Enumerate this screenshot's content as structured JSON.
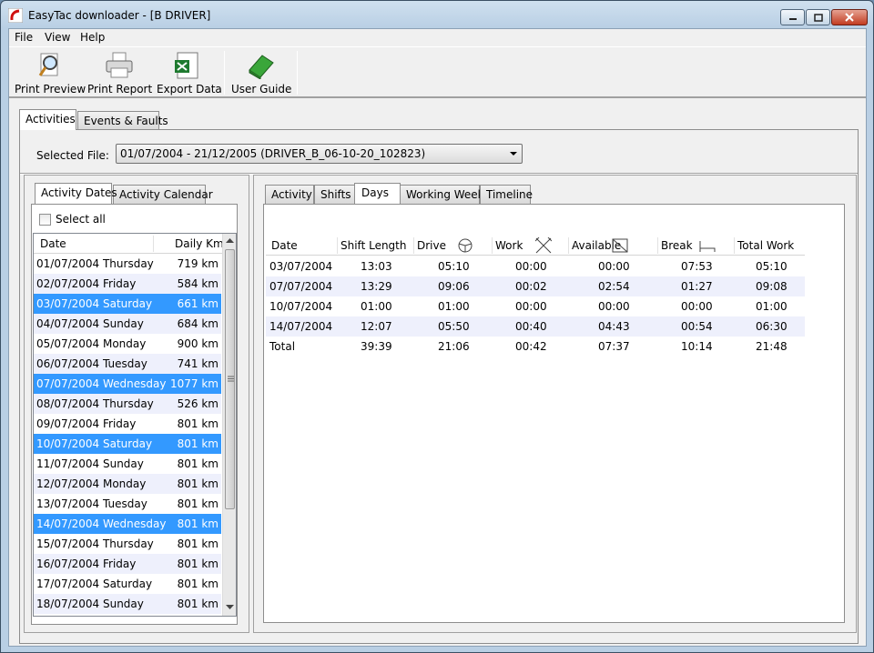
{
  "window": {
    "title": "EasyTac downloader - [B DRIVER]"
  },
  "menu": [
    "File",
    "View",
    "Help"
  ],
  "toolbar": {
    "print_preview": "Print Preview",
    "print_report": "Print Report",
    "export_data": "Export Data",
    "user_guide": "User Guide"
  },
  "main_tabs": [
    "Activities",
    "Events & Faults"
  ],
  "selected_file": {
    "label": "Selected File:",
    "value": "01/07/2004 - 21/12/2005 (DRIVER_B_06-10-20_102823)"
  },
  "left_tabs": [
    "Activity Dates",
    "Activity Calendar"
  ],
  "select_all": "Select all",
  "dates_list": {
    "columns": [
      "Date",
      "Daily Km"
    ],
    "rows": [
      {
        "date": "01/07/2004 Thursday",
        "km": "719 km",
        "selected": false
      },
      {
        "date": "02/07/2004 Friday",
        "km": "584 km",
        "selected": false
      },
      {
        "date": "03/07/2004 Saturday",
        "km": "661 km",
        "selected": true
      },
      {
        "date": "04/07/2004 Sunday",
        "km": "684 km",
        "selected": false
      },
      {
        "date": "05/07/2004 Monday",
        "km": "900 km",
        "selected": false
      },
      {
        "date": "06/07/2004 Tuesday",
        "km": "741 km",
        "selected": false
      },
      {
        "date": "07/07/2004 Wednesday",
        "km": "1077 km",
        "selected": true
      },
      {
        "date": "08/07/2004 Thursday",
        "km": "526 km",
        "selected": false
      },
      {
        "date": "09/07/2004 Friday",
        "km": "801 km",
        "selected": false
      },
      {
        "date": "10/07/2004 Saturday",
        "km": "801 km",
        "selected": true
      },
      {
        "date": "11/07/2004 Sunday",
        "km": "801 km",
        "selected": false
      },
      {
        "date": "12/07/2004 Monday",
        "km": "801 km",
        "selected": false
      },
      {
        "date": "13/07/2004 Tuesday",
        "km": "801 km",
        "selected": false
      },
      {
        "date": "14/07/2004 Wednesday",
        "km": "801 km",
        "selected": true
      },
      {
        "date": "15/07/2004 Thursday",
        "km": "801 km",
        "selected": false
      },
      {
        "date": "16/07/2004 Friday",
        "km": "801 km",
        "selected": false
      },
      {
        "date": "17/07/2004 Saturday",
        "km": "801 km",
        "selected": false
      },
      {
        "date": "18/07/2004 Sunday",
        "km": "801 km",
        "selected": false
      }
    ]
  },
  "right_tabs": [
    "Activity",
    "Shifts",
    "Days",
    "Working Week",
    "Timeline"
  ],
  "days_table": {
    "columns": [
      "Date",
      "Shift Length",
      "Drive",
      "Work",
      "Available",
      "Break",
      "Total Work"
    ],
    "column_icons": [
      "",
      "",
      "steering-wheel-icon",
      "crossed-hammers-icon",
      "available-box-icon",
      "bed-icon",
      ""
    ],
    "rows": [
      [
        "03/07/2004",
        "13:03",
        "05:10",
        "00:00",
        "00:00",
        "07:53",
        "05:10"
      ],
      [
        "07/07/2004",
        "13:29",
        "09:06",
        "00:02",
        "02:54",
        "01:27",
        "09:08"
      ],
      [
        "10/07/2004",
        "01:00",
        "01:00",
        "00:00",
        "00:00",
        "00:00",
        "01:00"
      ],
      [
        "14/07/2004",
        "12:07",
        "05:50",
        "00:40",
        "04:43",
        "00:54",
        "06:30"
      ],
      [
        "Total",
        "39:39",
        "21:06",
        "00:42",
        "07:37",
        "10:14",
        "21:48"
      ]
    ]
  },
  "colors": {
    "selection": "#3399ff",
    "alt_row": "#eef0fc"
  }
}
